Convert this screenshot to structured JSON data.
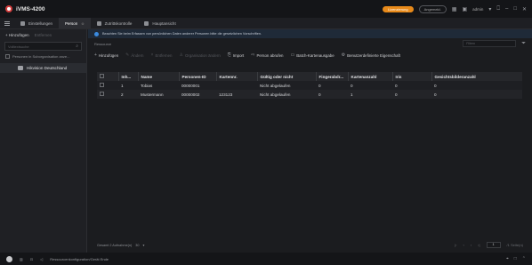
{
  "app": {
    "title": "iVMS-4200"
  },
  "titlebar": {
    "badge1": "Lizenzierung",
    "badge2": "Angemeld.",
    "user": "admin"
  },
  "tabs": [
    {
      "label": "Einstellungen"
    },
    {
      "label": "Person"
    },
    {
      "label": "Zutrittskontrolle"
    },
    {
      "label": "Hauptansicht"
    }
  ],
  "left": {
    "add_label": "+ Hinzufügen",
    "delete_label": "Entfernen",
    "search_placeholder": "Volltextsuche",
    "check_label": "Personen in Suborganisation anze...",
    "tree_item": "Hikvision Deutschland"
  },
  "notice": "Beachten Sie beim Erfassen von persönlichen Daten anderer Personen bitte die gesetzlichen Vorschriften.",
  "resource_label": "Ressource",
  "filter_placeholder": "Filtern",
  "toolbar": {
    "add": "Hinzufügen",
    "edit": "Ändern",
    "delete": "Entfernen",
    "change_org": "Organisation ändern",
    "import": "Import",
    "get_person": "Person abrufen",
    "batch_card": "Batch-Kartenausgabe",
    "custom_prop": "Benutzerdefinierte Eigenschaft"
  },
  "table": {
    "headers": [
      "",
      "Inh...",
      "Name",
      "Personen-ID",
      "Kartennr.",
      "Gültig oder nicht",
      "Fingerabdr...",
      "Kartenanzahl",
      "Iris",
      "Gesichtsbilderanzahl"
    ],
    "rows": [
      [
        "",
        "1",
        "Tobias",
        "00000001",
        "",
        "Nicht abgelaufen",
        "0",
        "0",
        "0",
        "0"
      ],
      [
        "",
        "2",
        "Mustermann",
        "00000002",
        "123123",
        "Nicht abgelaufen",
        "0",
        "1",
        "0",
        "0"
      ]
    ]
  },
  "footer": {
    "total": "Gesamt 2 Aufnahme(n)",
    "per_page": "30",
    "page": "1",
    "pages": "/1 Seite(n)"
  },
  "status": {
    "text": "Ressourcenkonfiguration/Gerät Ende"
  }
}
